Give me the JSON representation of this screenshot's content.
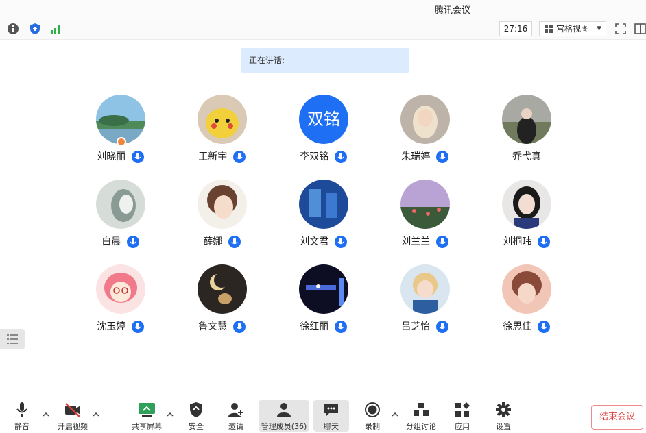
{
  "window": {
    "title": "腾讯会议"
  },
  "statusbar": {
    "info_icon": "info-icon",
    "shield_icon": "shield-icon",
    "signal_icon": "signal-icon",
    "timer": "27:16",
    "view_label": "宫格视图",
    "colors": {
      "shield": "#2a6be4",
      "signal": "#2fb049"
    }
  },
  "speaking": {
    "label": "正在讲话:"
  },
  "participants": [
    {
      "name": "刘晓丽"
    },
    {
      "name": "王新宇"
    },
    {
      "name": "李双铭",
      "avatar_text": "双铭"
    },
    {
      "name": "朱瑞婷"
    },
    {
      "name": "乔弋真"
    },
    {
      "name": "白晨"
    },
    {
      "name": "薛娜"
    },
    {
      "name": "刘文君"
    },
    {
      "name": "刘兰兰"
    },
    {
      "name": "刘桐玮"
    },
    {
      "name": "沈玉婷"
    },
    {
      "name": "鲁文慧"
    },
    {
      "name": "徐红丽"
    },
    {
      "name": "吕芝怡"
    },
    {
      "name": "徐思佳"
    }
  ],
  "toolbar": {
    "mute": "静音",
    "video": "开启视频",
    "share": "共享屏幕",
    "security": "安全",
    "invite": "邀请",
    "members": "管理成员(36)",
    "chat": "聊天",
    "record": "录制",
    "breakout": "分组讨论",
    "apps": "应用",
    "settings": "设置",
    "end": "结束会议"
  },
  "colors": {
    "accent": "#1f6ff5",
    "end": "#e23c3c",
    "speaking_bg": "#dcebfd",
    "host_badge": "#f0863b"
  }
}
